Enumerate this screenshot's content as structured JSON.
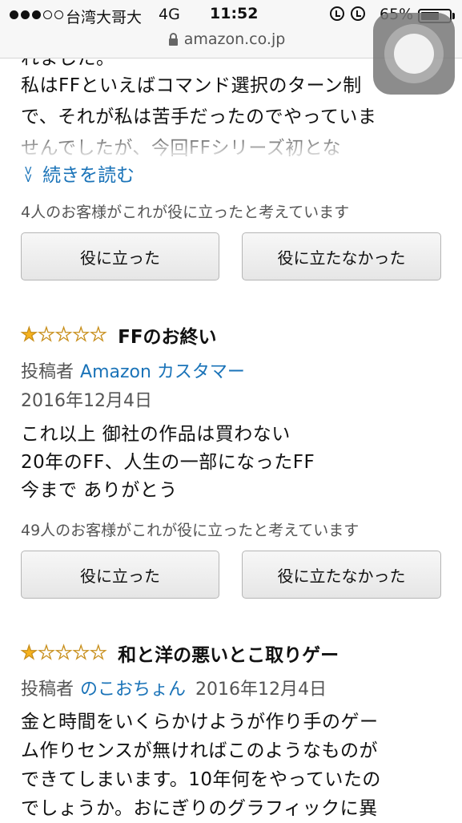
{
  "status_bar": {
    "carrier": "台湾大哥大",
    "network": "4G",
    "time": "11:52",
    "battery_percent": "65%",
    "battery_level": 0.65,
    "signal_bars_filled": 3,
    "signal_bars_total": 5
  },
  "browser": {
    "url": "amazon.co.jp"
  },
  "previous_review": {
    "lines": [
      "れました。",
      "私はFFといえばコマンド選択のターン制",
      "で、それが私は苦手だったのでやっていま",
      "せんでしたが、今回FFシリーズ初とな"
    ],
    "read_more": "続きを読む",
    "helpful_count_text": "4人のお客様がこれが役に立ったと考えています",
    "helpful_button": "役に立った",
    "not_helpful_button": "役に立たなかった"
  },
  "reviews": [
    {
      "rating": 1,
      "max_rating": 5,
      "title": "FFのお終い",
      "byline_label": "投稿者",
      "author": "Amazon カスタマー",
      "date": "2016年12月4日",
      "body": [
        "これ以上 御社の作品は買わない",
        "20年のFF、人生の一部になったFF",
        "今まで ありがとう"
      ],
      "helpful_count_text": "49人のお客様がこれが役に立ったと考えています",
      "helpful_button": "役に立った",
      "not_helpful_button": "役に立たなかった"
    },
    {
      "rating": 1,
      "max_rating": 5,
      "title": "和と洋の悪いとこ取りゲー",
      "byline_label": "投稿者",
      "author": "のこおちょん",
      "date": "2016年12月4日",
      "body": [
        "金と時間をいくらかけようが作り手のゲー",
        "ム作りセンスが無ければこのようなものが",
        "できてしまいます。10年何をやっていたの",
        "でしょうか。おにぎりのグラフィックに異"
      ]
    }
  ],
  "colors": {
    "link": "#1a73b8",
    "star": "#f6b21d"
  }
}
